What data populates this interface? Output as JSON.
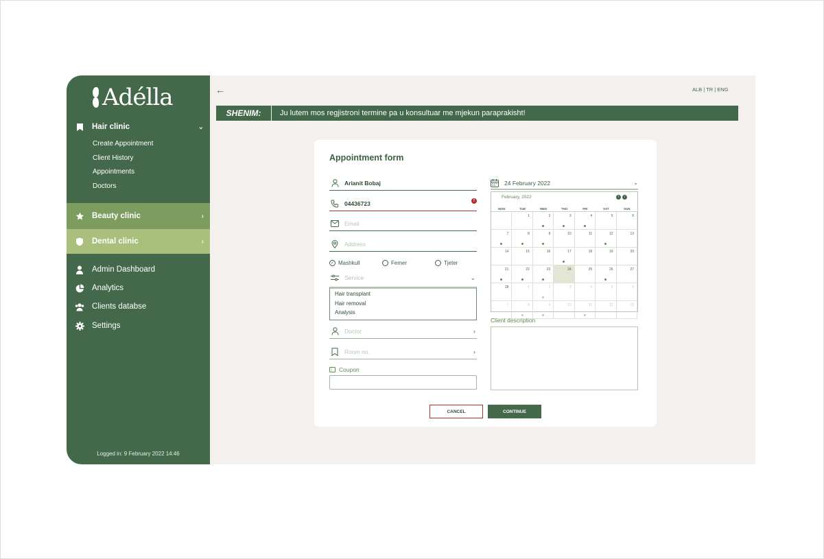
{
  "brand": {
    "name": "Adélla"
  },
  "sidebar": {
    "hair_clinic": {
      "label": "Hair clinic",
      "items": [
        "Create Appointment",
        "Client History",
        "Appointments",
        "Doctors"
      ]
    },
    "beauty_clinic": {
      "label": "Beauty clinic"
    },
    "dental_clinic": {
      "label": "Dental clinic"
    },
    "nav": [
      {
        "label": "Admin Dashboard",
        "icon": "user-icon"
      },
      {
        "label": "Analytics",
        "icon": "pie-chart-icon"
      },
      {
        "label": "Clients databse",
        "icon": "users-icon"
      },
      {
        "label": "Settings",
        "icon": "gear-icon"
      }
    ],
    "logged_in": "Logged in: 9 February 2022 14:46"
  },
  "header": {
    "languages": "ALB | TR | ENG",
    "note_label": "SHENIM:",
    "note_text": "Ju lutem mos regjistroni termine pa u konsultuar me mjekun paraprakisht!"
  },
  "form": {
    "title": "Appointment form",
    "name_value": "Arianit Bobaj",
    "phone_value": "04436723",
    "email_placeholder": "Email",
    "address_placeholder": "Address",
    "gender_options": [
      "Mashkull",
      "Femer",
      "Tjeter"
    ],
    "gender_selected": "Mashkull",
    "service_placeholder": "Service",
    "service_options": [
      "Hair transplant",
      "Hair removal",
      "Analysis"
    ],
    "doctor_placeholder": "Doctor",
    "room_placeholder": "Room no.",
    "coupon_label": "Coupon",
    "date_value": "24 February 2022",
    "description_label": "Client description",
    "cancel_label": "CANCEL",
    "continue_label": "CONTINUE"
  },
  "calendar": {
    "month_label": "February, 2022",
    "weekdays": [
      "MON",
      "TUE",
      "WED",
      "THU",
      "FRI",
      "SAT",
      "SUN"
    ],
    "days": [
      {
        "n": "",
        "o": true,
        "d": false
      },
      {
        "n": "1",
        "o": false,
        "d": false
      },
      {
        "n": "2",
        "o": false,
        "d": true
      },
      {
        "n": "3",
        "o": false,
        "d": true
      },
      {
        "n": "4",
        "o": false,
        "d": true
      },
      {
        "n": "5",
        "o": false,
        "d": false
      },
      {
        "n": "6",
        "o": false,
        "d": false
      },
      {
        "n": "7",
        "o": false,
        "d": true
      },
      {
        "n": "8",
        "o": false,
        "d": true
      },
      {
        "n": "9",
        "o": false,
        "d": true
      },
      {
        "n": "10",
        "o": false,
        "d": false
      },
      {
        "n": "11",
        "o": false,
        "d": false
      },
      {
        "n": "12",
        "o": false,
        "d": true
      },
      {
        "n": "13",
        "o": false,
        "d": false
      },
      {
        "n": "14",
        "o": false,
        "d": false
      },
      {
        "n": "15",
        "o": false,
        "d": false
      },
      {
        "n": "16",
        "o": false,
        "d": false
      },
      {
        "n": "17",
        "o": false,
        "d": true
      },
      {
        "n": "18",
        "o": false,
        "d": false
      },
      {
        "n": "19",
        "o": false,
        "d": false
      },
      {
        "n": "20",
        "o": false,
        "d": false
      },
      {
        "n": "21",
        "o": false,
        "d": true
      },
      {
        "n": "22",
        "o": false,
        "d": true
      },
      {
        "n": "23",
        "o": false,
        "d": true
      },
      {
        "n": "24",
        "o": false,
        "d": false,
        "s": true
      },
      {
        "n": "25",
        "o": false,
        "d": false
      },
      {
        "n": "26",
        "o": false,
        "d": true
      },
      {
        "n": "27",
        "o": false,
        "d": false
      },
      {
        "n": "28",
        "o": false,
        "d": false
      },
      {
        "n": "1",
        "o": true,
        "d": false
      },
      {
        "n": "2",
        "o": true,
        "d": true
      },
      {
        "n": "3",
        "o": true,
        "d": false
      },
      {
        "n": "4",
        "o": true,
        "d": false
      },
      {
        "n": "5",
        "o": true,
        "d": false
      },
      {
        "n": "6",
        "o": true,
        "d": false
      },
      {
        "n": "7",
        "o": true,
        "d": false
      },
      {
        "n": "8",
        "o": true,
        "d": true
      },
      {
        "n": "9",
        "o": true,
        "d": true
      },
      {
        "n": "10",
        "o": true,
        "d": false
      },
      {
        "n": "11",
        "o": true,
        "d": true
      },
      {
        "n": "12",
        "o": true,
        "d": false
      },
      {
        "n": "13",
        "o": true,
        "d": false
      }
    ]
  },
  "colors": {
    "sidebar_bg": "#44694a",
    "beauty_bg": "#7d9c5f",
    "dental_bg": "#a9bf7b",
    "page_bg": "#f3f0ed",
    "error": "#b32f2f"
  }
}
